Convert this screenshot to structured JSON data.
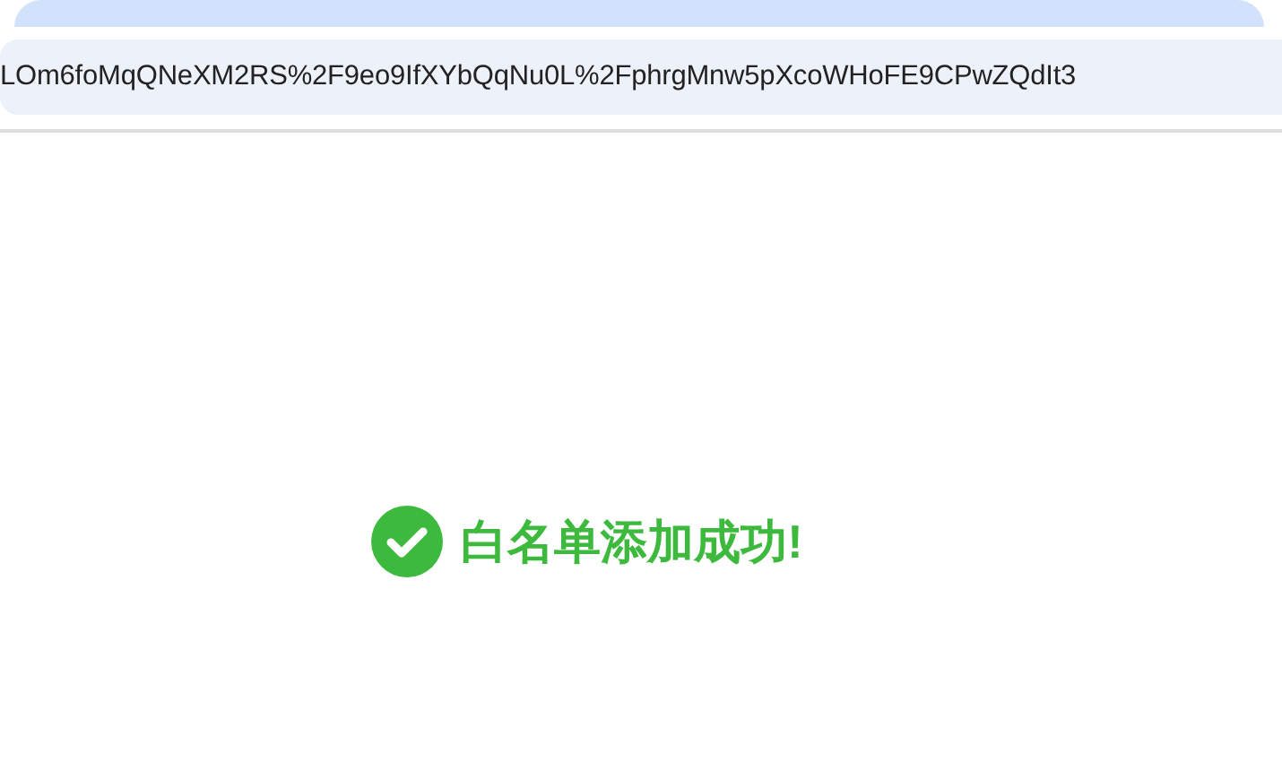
{
  "address_bar": {
    "value": "LOm6foMqQNeXM2RS%2F9eo9IfXYbQqNu0L%2FphrgMnw5pXcoWHoFE9CPwZQdIt3"
  },
  "message": {
    "kind": "success",
    "text": "白名单添加成功!"
  }
}
